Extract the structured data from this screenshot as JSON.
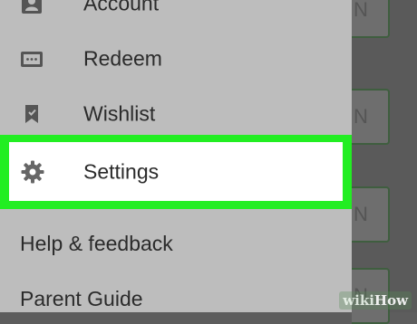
{
  "drawer": {
    "items": [
      {
        "label": "Account",
        "icon": "account-icon"
      },
      {
        "label": "Redeem",
        "icon": "redeem-icon"
      },
      {
        "label": "Wishlist",
        "icon": "bookmark-icon"
      }
    ],
    "settings": {
      "label": "Settings",
      "icon": "gear-icon",
      "highlight_color": "#22ee22"
    },
    "help_label": "Help & feedback",
    "parent_label": "Parent Guide"
  },
  "background": {
    "button_fragment": "N"
  },
  "watermark": {
    "wiki": "wiki",
    "how": "How"
  }
}
